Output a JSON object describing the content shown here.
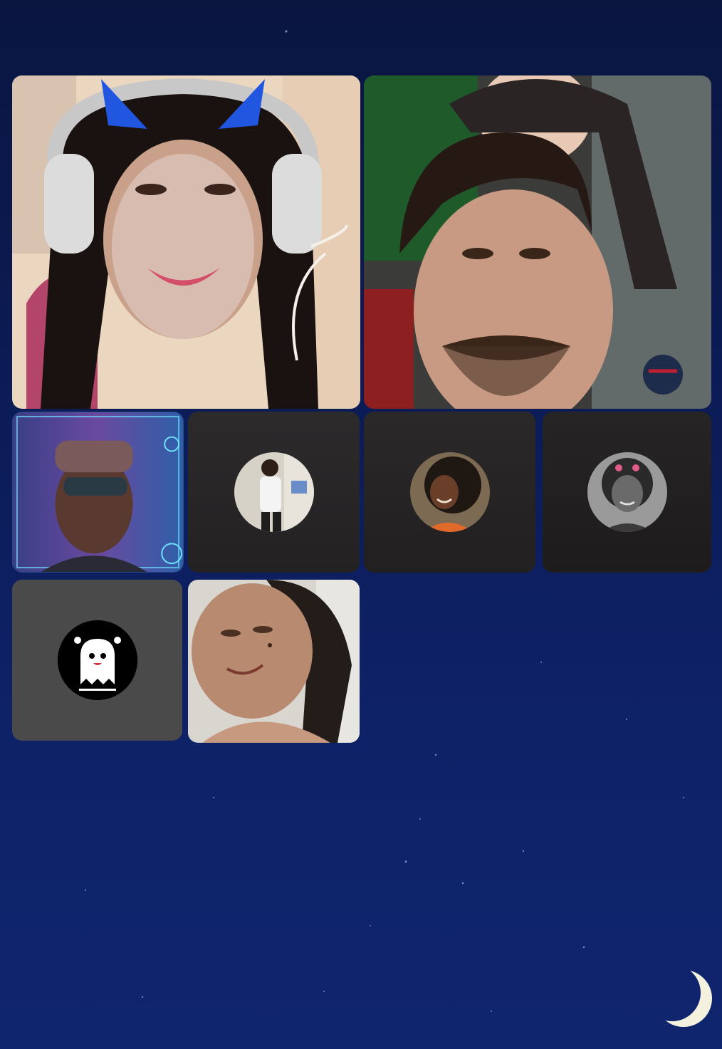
{
  "call": {
    "participants": [
      {
        "id": "p1",
        "kind": "video",
        "description_icon": "participant-video-icon"
      },
      {
        "id": "p2",
        "kind": "video",
        "description_icon": "participant-video-icon"
      },
      {
        "id": "p3",
        "kind": "video",
        "description_icon": "participant-video-icon"
      },
      {
        "id": "p4",
        "kind": "avatar",
        "description_icon": "profile-avatar-icon"
      },
      {
        "id": "p5",
        "kind": "avatar",
        "description_icon": "profile-avatar-icon"
      },
      {
        "id": "p6",
        "kind": "avatar",
        "description_icon": "profile-avatar-icon"
      },
      {
        "id": "p7",
        "kind": "avatar",
        "description_icon": "ghost-icon"
      },
      {
        "id": "p8",
        "kind": "video",
        "description_icon": "participant-video-icon"
      }
    ]
  },
  "colors": {
    "background_top": "#0a1540",
    "background_bottom": "#0f256e",
    "tile_dark": "#252324",
    "tile_gray": "#4a4a4a",
    "moon": "#f4f1de"
  }
}
